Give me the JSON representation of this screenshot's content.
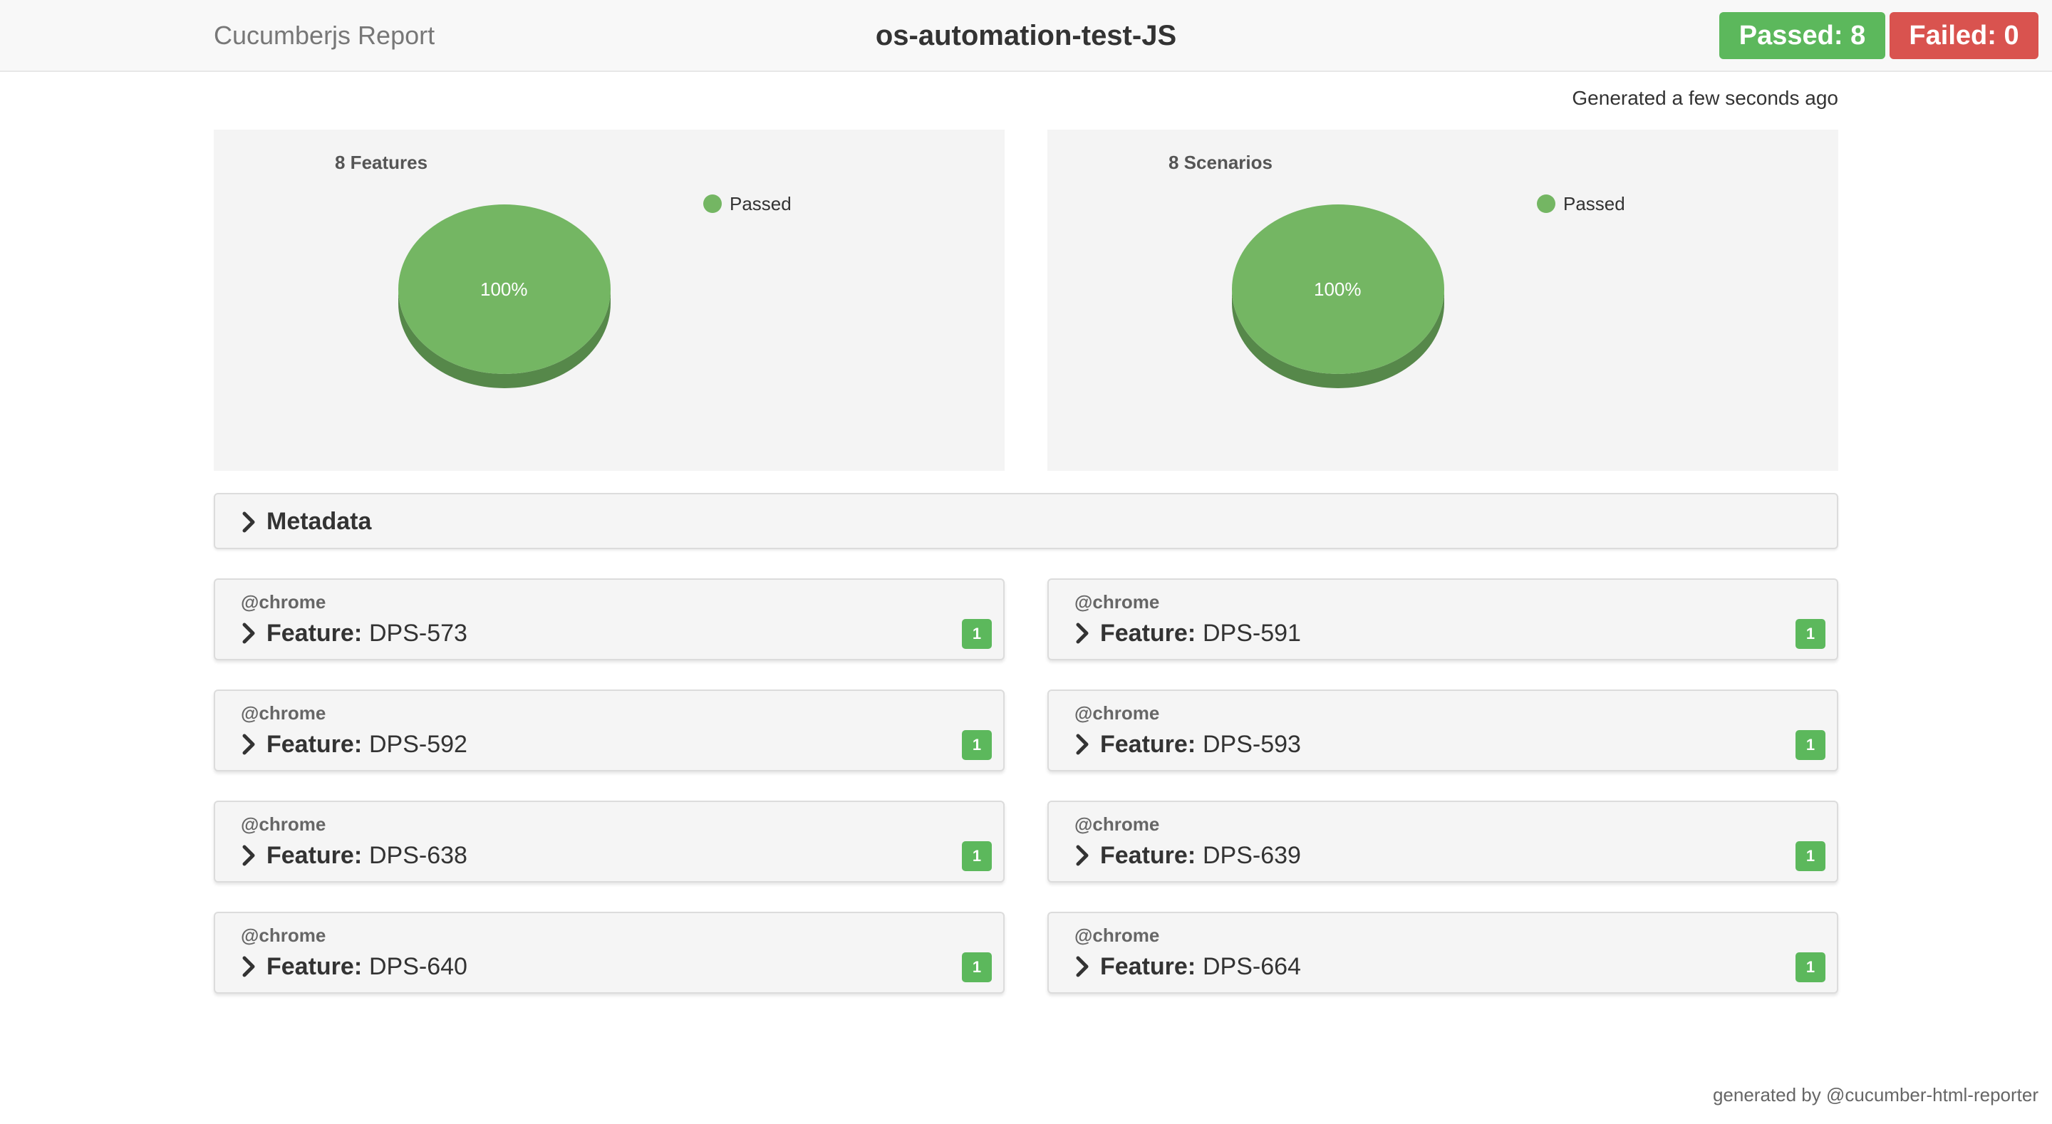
{
  "header": {
    "brand": "Cucumberjs Report",
    "project_title": "os-automation-test-JS",
    "passed_label": "Passed: 8",
    "failed_label": "Failed: 0"
  },
  "generated_text": "Generated a few seconds ago",
  "colors": {
    "passed": "#5cb85c",
    "failed": "#d9534f",
    "pie_top": "#74b663",
    "pie_side": "#56884a"
  },
  "chart_data": [
    {
      "type": "pie",
      "title": "8 Features",
      "slices": [
        {
          "label": "Passed",
          "value": 100,
          "display": "100%"
        }
      ],
      "legend": [
        "Passed"
      ],
      "legend_placement": "top-right"
    },
    {
      "type": "pie",
      "title": "8 Scenarios",
      "slices": [
        {
          "label": "Passed",
          "value": 100,
          "display": "100%"
        }
      ],
      "legend": [
        "Passed"
      ],
      "legend_placement": "top-right"
    }
  ],
  "metadata": {
    "label": "Metadata"
  },
  "feature_keyword": "Feature:",
  "features": [
    {
      "tag": "@chrome",
      "name": "DPS-573",
      "count": "1"
    },
    {
      "tag": "@chrome",
      "name": "DPS-591",
      "count": "1"
    },
    {
      "tag": "@chrome",
      "name": "DPS-592",
      "count": "1"
    },
    {
      "tag": "@chrome",
      "name": "DPS-593",
      "count": "1"
    },
    {
      "tag": "@chrome",
      "name": "DPS-638",
      "count": "1"
    },
    {
      "tag": "@chrome",
      "name": "DPS-639",
      "count": "1"
    },
    {
      "tag": "@chrome",
      "name": "DPS-640",
      "count": "1"
    },
    {
      "tag": "@chrome",
      "name": "DPS-664",
      "count": "1"
    }
  ],
  "footer": "generated by @cucumber-html-reporter"
}
